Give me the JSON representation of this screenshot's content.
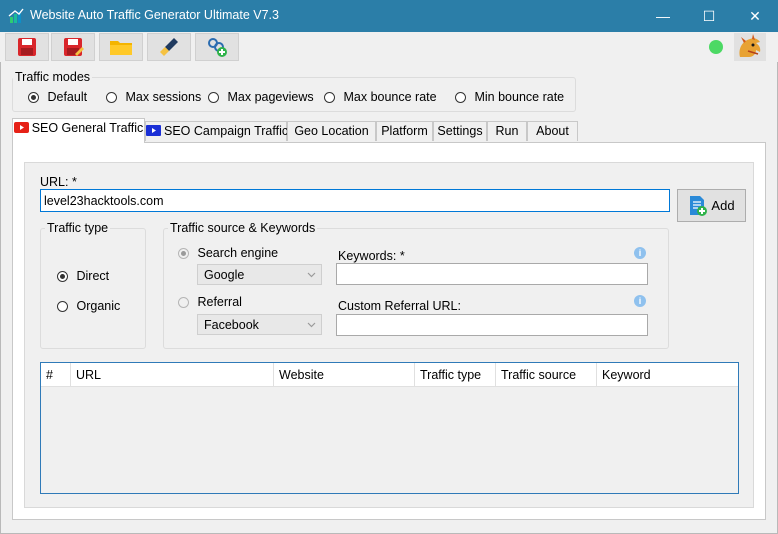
{
  "window": {
    "title": "Website Auto Traffic Generator Ultimate V7.3"
  },
  "window_controls": {
    "minimize": "—",
    "maximize": "☐",
    "close": "✕"
  },
  "toolbar": {
    "buttons": [
      "save-icon",
      "save-as-icon",
      "open-folder-icon",
      "clean-brush-icon",
      "network-add-icon"
    ],
    "status_color": "#4cd964"
  },
  "traffic_modes": {
    "legend": "Traffic modes",
    "options": [
      "Default",
      "Max sessions",
      "Max pageviews",
      "Max bounce rate",
      "Min bounce rate"
    ],
    "selected": "Default"
  },
  "tabs": [
    "SEO General Traffic",
    "SEO Campaign Traffic",
    "Geo Location",
    "Platform",
    "Settings",
    "Run",
    "About"
  ],
  "active_tab": "SEO General Traffic",
  "url_section": {
    "label": "URL: *",
    "value": "level23hacktools.com",
    "add_label": "Add"
  },
  "traffic_type": {
    "legend": "Traffic type",
    "options": [
      "Direct",
      "Organic"
    ],
    "selected": "Direct"
  },
  "traffic_source": {
    "legend": "Traffic source & Keywords",
    "search_engine_label": "Search engine",
    "search_engine_value": "Google",
    "referral_label": "Referral",
    "referral_value": "Facebook",
    "keywords_label": "Keywords: *",
    "keywords_value": "",
    "custom_referral_label": "Custom Referral URL:",
    "custom_referral_value": "",
    "info_glyph": "i"
  },
  "table": {
    "columns": [
      "#",
      "URL",
      "Website",
      "Traffic type",
      "Traffic source",
      "Keyword"
    ],
    "rows": []
  },
  "colors": {
    "titlebar": "#2b7ea8",
    "accent": "#0078d7",
    "status_dot": "#4cd964"
  }
}
